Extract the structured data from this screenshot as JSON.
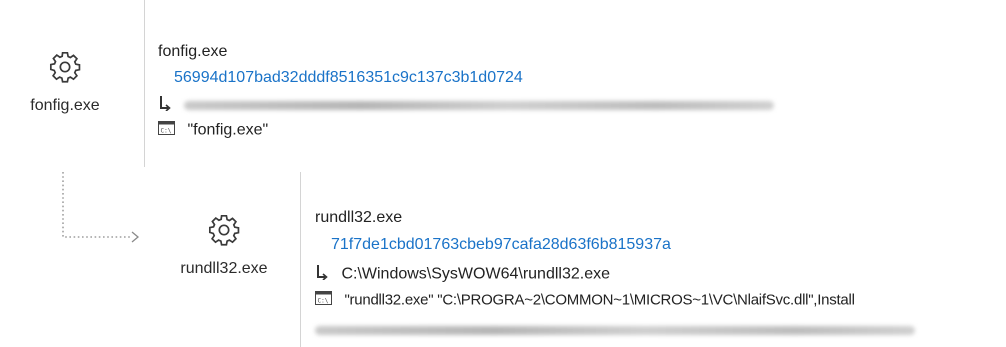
{
  "parent": {
    "icon": "gear-icon",
    "name": "fonfig.exe",
    "image_name": "fonfig.exe",
    "hash": "56994d107bad32dddf8516351c9c137c3b1d0724",
    "path_icon": "path-arrow-icon",
    "command_icon": "command-line-icon",
    "command_line": "\"fonfig.exe\""
  },
  "child": {
    "icon": "gear-icon",
    "name": "rundll32.exe",
    "image_name": "rundll32.exe",
    "hash": "71f7de1cbd01763cbeb97cafa28d63f6b815937a",
    "path_icon": "path-arrow-icon",
    "path": "C:\\Windows\\SysWOW64\\rundll32.exe",
    "command_icon": "command-line-icon",
    "command_line": "\"rundll32.exe\" \"C:\\PROGRA~2\\COMMON~1\\MICROS~1\\VC\\NlaifSvc.dll\",Install"
  },
  "colors": {
    "hash": "#1a73c8",
    "text": "#222222",
    "divider": "#d4d4d4",
    "connector": "#8a8a8a"
  }
}
